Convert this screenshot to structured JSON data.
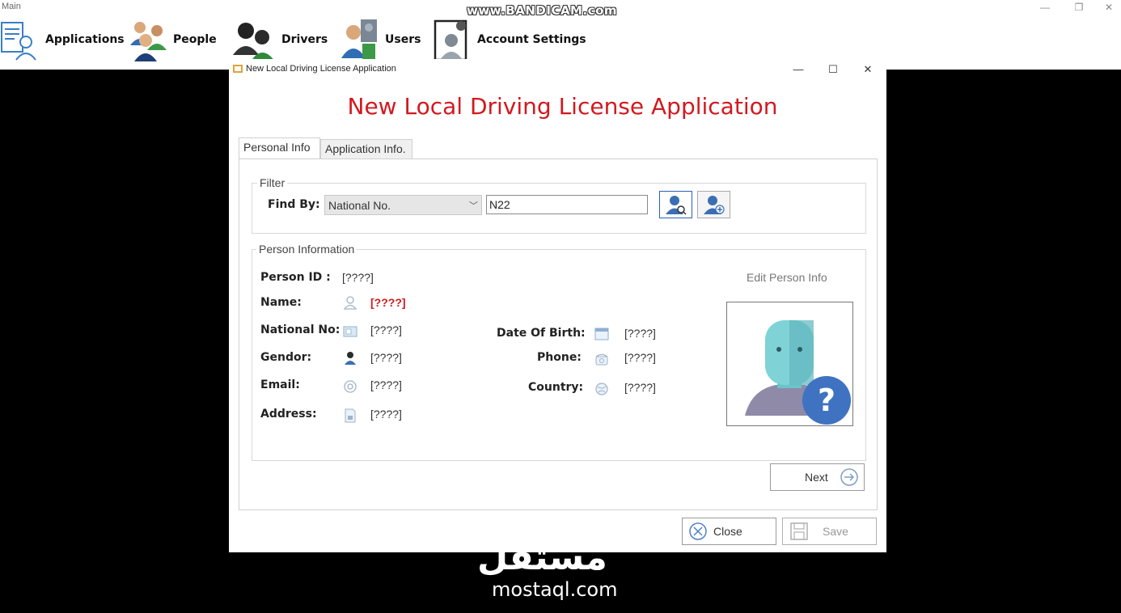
{
  "main_window": {
    "title": "Main",
    "menu": [
      {
        "label": "Applications",
        "icon": "applications-icon"
      },
      {
        "label": "People",
        "icon": "people-icon"
      },
      {
        "label": "Drivers",
        "icon": "drivers-icon"
      },
      {
        "label": "Users",
        "icon": "users-icon"
      },
      {
        "label": "Account Settings",
        "icon": "account-settings-icon"
      }
    ],
    "controls": {
      "minimize": "—",
      "restore": "❐",
      "close": "✕"
    }
  },
  "watermarks": {
    "bandicam": "www.BANDICAM.com",
    "mostaql_arabic": "مستقل",
    "mostaql_latin": "mostaql.com"
  },
  "dialog": {
    "title": "New Local Driving License Application",
    "controls": {
      "minimize": "—",
      "maximize": "☐",
      "close": "✕"
    },
    "heading": "New Local Driving License Application",
    "heading_color": "#d2191f",
    "tabs": [
      {
        "label": "Personal Info",
        "selected": true
      },
      {
        "label": "Application Info.",
        "selected": false
      }
    ],
    "filter": {
      "group_title": "Filter",
      "find_by_label": "Find By:",
      "find_by_value": "National No.",
      "search_value": "N22"
    },
    "person": {
      "group_title": "Person Information",
      "edit_link": "Edit Person Info",
      "person_id_label": "Person ID :",
      "person_id_value": "[????]",
      "fields_left": [
        {
          "label": "Name:",
          "value": "[????]",
          "icon": "person-outline-icon"
        },
        {
          "label": "National No:",
          "value": "[????]",
          "icon": "id-card-icon"
        },
        {
          "label": "Gendor:",
          "value": "[????]",
          "icon": "gender-person-icon"
        },
        {
          "label": "Email:",
          "value": "[????]",
          "icon": "at-sign-icon"
        },
        {
          "label": "Address:",
          "value": "[????]",
          "icon": "address-document-icon"
        }
      ],
      "fields_right": [
        {
          "label": "Date Of Birth:",
          "value": "[????]",
          "icon": "calendar-icon"
        },
        {
          "label": "Phone:",
          "value": "[????]",
          "icon": "phone-icon"
        },
        {
          "label": "Country:",
          "value": "[????]",
          "icon": "globe-icon"
        }
      ]
    },
    "buttons": {
      "next": "Next",
      "close": "Close",
      "save": "Save"
    }
  }
}
